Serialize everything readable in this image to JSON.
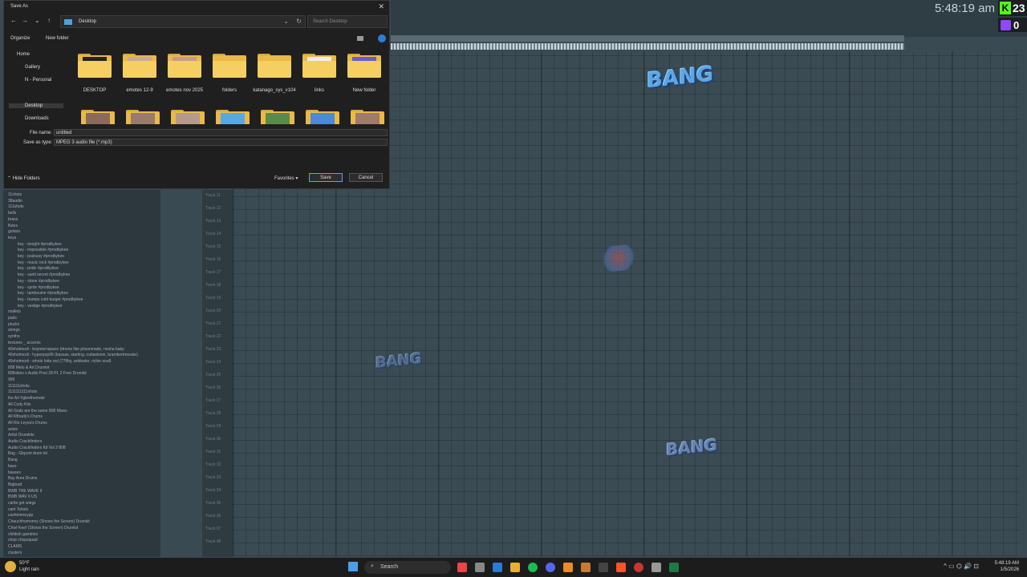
{
  "dialog": {
    "title": "Save As",
    "address": "Desktop",
    "search_placeholder": "Search Desktop",
    "organize": "Organize",
    "new_folder": "New folder",
    "nav": [
      "Home",
      "Gallery",
      "N - Personal",
      "Desktop",
      "Downloads"
    ],
    "folders": [
      {
        "name": "DESKTOP",
        "thumb": "#2a2a2a"
      },
      {
        "name": "emotes 12-9",
        "thumb": "#c9a79a"
      },
      {
        "name": "emotes nov 2025",
        "thumb": "#c79a8f"
      },
      {
        "name": "folders",
        "thumb": ""
      },
      {
        "name": "katanago_sys_v104",
        "thumb": ""
      },
      {
        "name": "links",
        "thumb": "#e8e8e8"
      },
      {
        "name": "New folder",
        "thumb": "#6a5acd"
      }
    ],
    "file_name_label": "File name:",
    "file_name": "untitled",
    "save_type_label": "Save as type:",
    "save_type": "MPEG 3 audio file (*.mp3)",
    "hide_folders": "Hide Folders",
    "favorites": "Favorites",
    "save": "Save",
    "cancel": "Cancel"
  },
  "overlay": {
    "clock": "5:48:19 am",
    "kick_count": "23",
    "twitch_count": "0"
  },
  "graphics": {
    "bang_text": "BANG"
  },
  "browser": {
    "items": [
      "11shots",
      "38audio",
      "111shots",
      "bells",
      "brass",
      "flutes",
      "guitars",
      "keys",
      "key - tonight #prodbykee",
      "key - impossible #prodbykee",
      "key - jealousy #prodbykee",
      "key - music rock #prodbykee",
      "key - pride #prodbykee",
      "key - santi secret #prodbykee",
      "key - stone #prodbykee",
      "key - syrite #prodbykee",
      "key - tambouine #prodbykee",
      "key - trumps cold burger #prodbykee",
      "key - vestige #prodbykee",
      "mallets",
      "pads",
      "plucks",
      "strings",
      "synths",
      "textures _ accents",
      "40shotmodi - boymornspace (drums like jetsonmade, nesha baby",
      "40shotmodi - hyperpop99 (bassas, starting, outlastown, brambertmessie)",
      "40shotmodi - whole lotta red (778hy, artdealer, richie souf)",
      "808 Melo & Art Drumkit",
      "808skins x Audio Post 28 Pt. 2 Free Drumkit",
      "999",
      "111111shots",
      "1111111111shots",
      "Ike Art #gleethemate",
      "All Cody Kits",
      "All Gods are the same 808 Mixes",
      "All KBrady's Drums",
      "All Rio Leyva's Drums",
      "arists",
      "Artist Drumkits",
      "Audio Crackfinders",
      "Audio Crackfinders Kit Vol 2 808",
      "Bag - Gbpunt drum kit",
      "Bang",
      "bass",
      "basses",
      "Bay Area Drums",
      "Bigbrad",
      "BWB THE WAVE 9",
      "BWB WAV 6 US",
      "cartie got wingz",
      "carti Tshots",
      "cashmeneypp",
      "Chauchhomonny (Shows the Screen) Drumkit",
      "Chief Keef (Shows the Screen) Drumkit",
      "childish gambino",
      "chop chopsquad",
      "CLAMS",
      "clusters"
    ]
  },
  "tracks": [
    "Track 11",
    "Track 12",
    "Track 13",
    "Track 14",
    "Track 15",
    "Track 16",
    "Track 17",
    "Track 18",
    "Track 19",
    "Track 20",
    "Track 21",
    "Track 22",
    "Track 23",
    "Track 24",
    "Track 25",
    "Track 26",
    "Track 27",
    "Track 28",
    "Track 29",
    "Track 30",
    "Track 31",
    "Track 32",
    "Track 33",
    "Track 34",
    "Track 35",
    "Track 36",
    "Track 37",
    "Track 38"
  ],
  "taskbar": {
    "weather_temp": "50°F",
    "weather_desc": "Light rain",
    "search": "Search",
    "time": "5:48:19 AM",
    "date": "1/5/2026"
  }
}
